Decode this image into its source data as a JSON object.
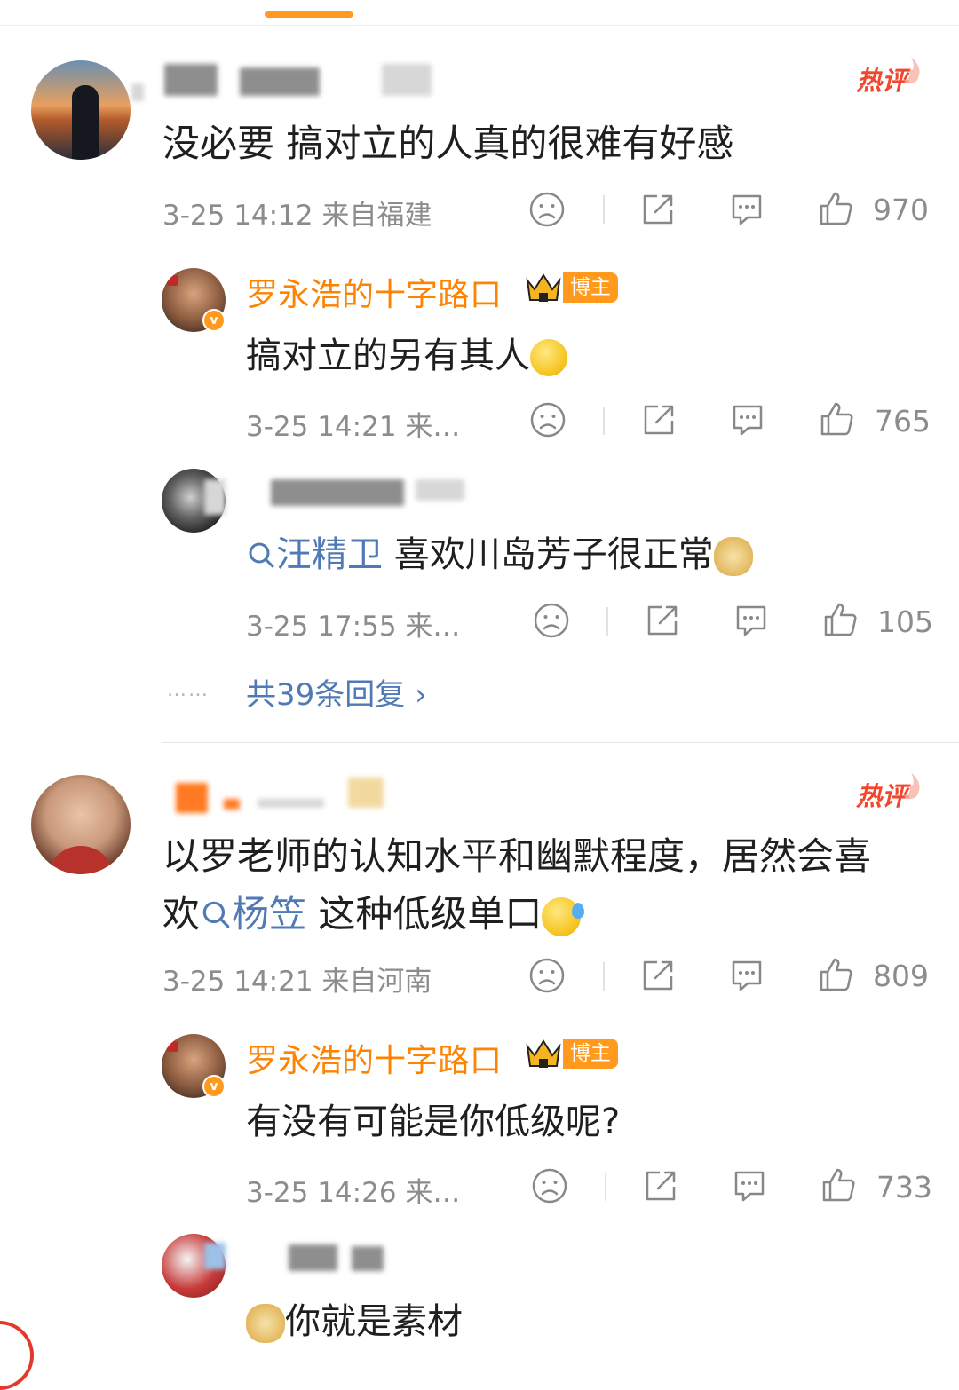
{
  "comments": [
    {
      "text": "没必要   搞对立的人真的很难有好感",
      "badge": "热评",
      "timestamp": "3-25 14:12",
      "location": "来自福建",
      "likes": "970",
      "replies": [
        {
          "nickname": "罗永浩的十字路口",
          "role_badge": "博主",
          "text": "搞对立的另有其人",
          "timestamp": "3-25 14:21",
          "location_truncated": "来…",
          "likes": "765"
        },
        {
          "text_topic": "汪精卫",
          "text_rest": " 喜欢川岛芳子很正常",
          "timestamp": "3-25 17:55",
          "location_truncated": "来…",
          "likes": "105"
        }
      ],
      "more_replies": "共39条回复 ›"
    },
    {
      "text_line1": "以罗老师的认知水平和幽默程度，居然会喜",
      "text_line2_pre": "欢",
      "text_line2_topic": "杨笠",
      "text_line2_rest": " 这种低级单口",
      "badge": "热评",
      "timestamp": "3-25 14:21",
      "location": "来自河南",
      "likes": "809",
      "replies": [
        {
          "nickname": "罗永浩的十字路口",
          "role_badge": "博主",
          "text": "有没有可能是你低级呢?",
          "timestamp": "3-25 14:26",
          "location_truncated": "来…",
          "likes": "733"
        },
        {
          "text": "你就是素材"
        }
      ]
    }
  ],
  "more_dots": "……",
  "icons": {
    "dislike": "frown-face-icon",
    "share": "share-icon",
    "comment": "comment-icon",
    "like": "thumbs-up-icon",
    "topic": "search-icon",
    "hot": "flame-icon",
    "crown": "crown-icon",
    "verified": "verified-badge-icon"
  },
  "colors": {
    "accent": "#ff8200",
    "hot": "#f2462d",
    "link": "#4f7ab5",
    "meta": "#8c8c8c",
    "tab_indicator": "#ff9a1f"
  }
}
